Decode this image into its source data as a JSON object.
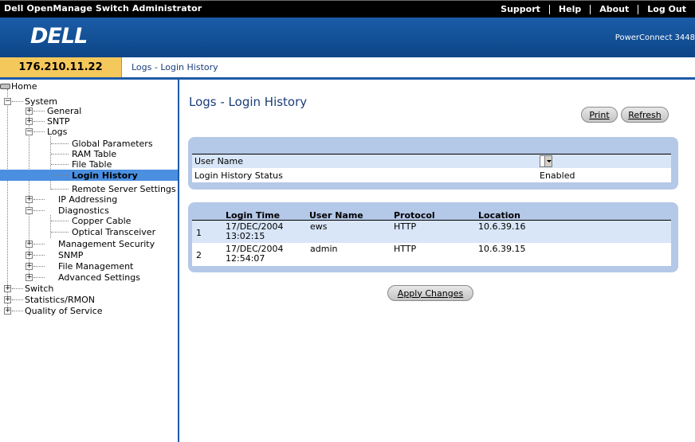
{
  "app": {
    "title": "Dell OpenManage Switch Administrator",
    "menu": [
      "Support",
      "Help",
      "About",
      "Log Out"
    ],
    "logo_text": "DELL",
    "model": "PowerConnect 3448"
  },
  "breadcrumb": {
    "ip": "176.210.11.22",
    "path": "Logs - Login History"
  },
  "tree": {
    "home": "Home",
    "system": "System",
    "general": "General",
    "sntp": "SNTP",
    "logs": "Logs",
    "global_parameters": "Global Parameters",
    "ram_table": "RAM Table",
    "file_table": "File Table",
    "login_history": "Login History",
    "remote_server_settings": "Remote Server Settings",
    "ip_addressing": "IP Addressing",
    "diagnostics": "Diagnostics",
    "copper_cable": "Copper Cable",
    "optical_transceiver": "Optical Transceiver",
    "management_security": "Management Security",
    "snmp": "SNMP",
    "file_management": "File Management",
    "advanced_settings": "Advanced Settings",
    "switch": "Switch",
    "statistics_rmon": "Statistics/RMON",
    "quality_of_service": "Quality of Service"
  },
  "main": {
    "title": "Logs - Login History",
    "print_label": "Print",
    "refresh_label": "Refresh",
    "user_name_label": "User Name",
    "user_name_value": "",
    "status_label": "Login History Status",
    "status_value": "Enabled",
    "apply_label": "Apply Changes",
    "table": {
      "headers": [
        "Login Time",
        "User Name",
        "Protocol",
        "Location"
      ],
      "rows": [
        {
          "index": "1",
          "time_date": "17/DEC/2004",
          "time_clock": "13:02:15",
          "user": "ews",
          "protocol": "HTTP",
          "location": "10.6.39.16"
        },
        {
          "index": "2",
          "time_date": "17/DEC/2004",
          "time_clock": "12:54:07",
          "user": "admin",
          "protocol": "HTTP",
          "location": "10.6.39.15"
        }
      ]
    }
  },
  "colors": {
    "banner": "#135095",
    "ip_box": "#f5c85c",
    "panel": "#b4c8e8",
    "row_alt": "#d8e6f8",
    "selected": "#4a8fe0",
    "title": "#1a3d7a"
  }
}
